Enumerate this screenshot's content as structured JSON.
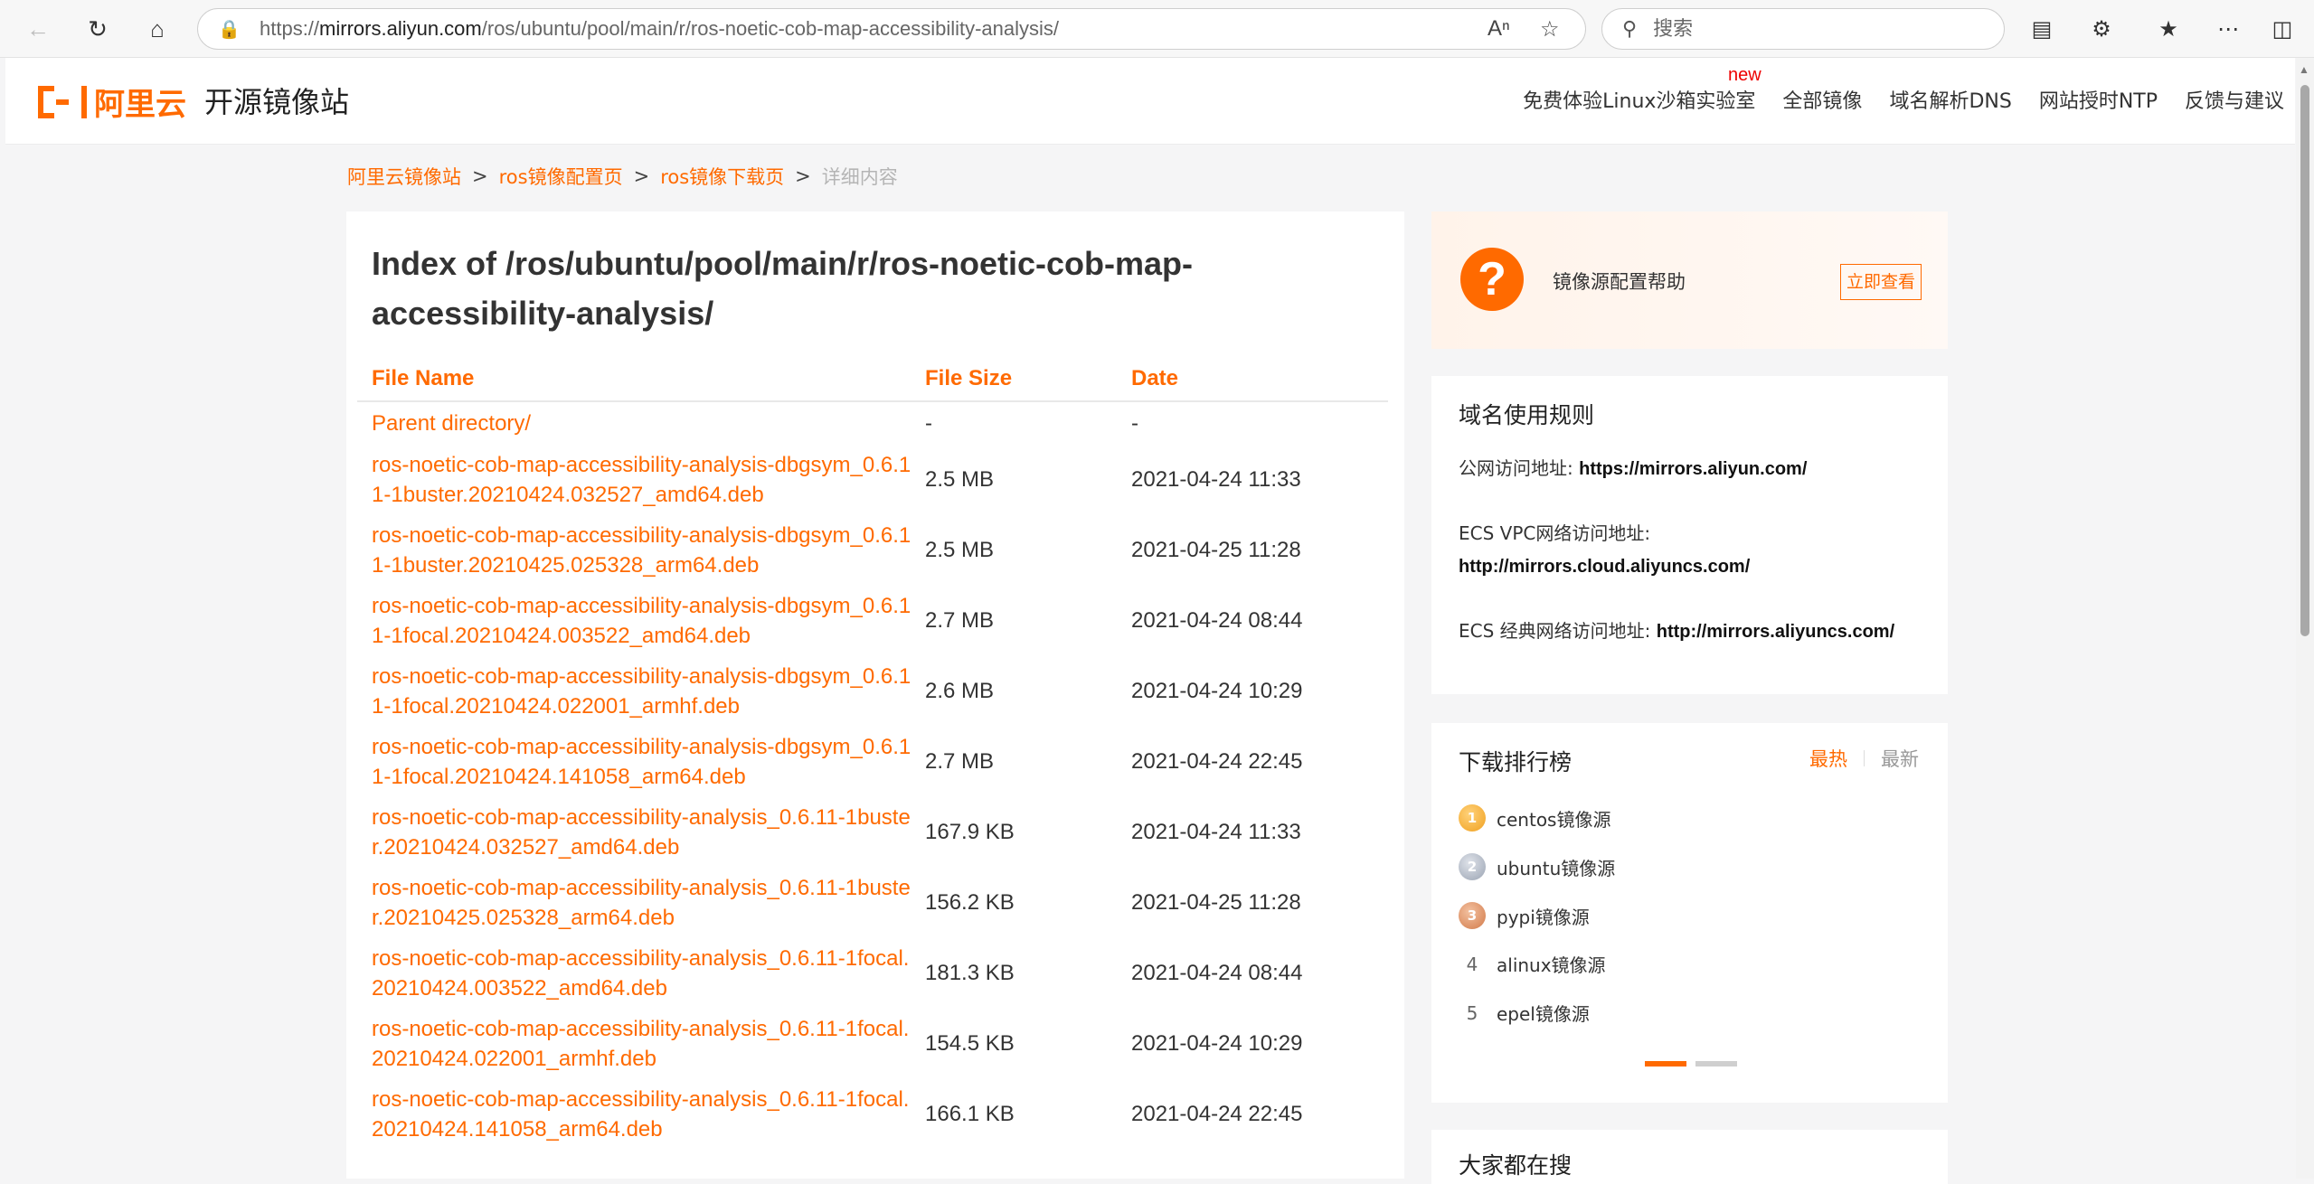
{
  "browser": {
    "url_prefix": "https://",
    "url_domain": "mirrors.aliyun.com",
    "url_path": "/ros/ubuntu/pool/main/r/ros-noetic-cob-map-accessibility-analysis/",
    "search_placeholder": "搜索",
    "icons": [
      "back-arrow-icon",
      "refresh-icon",
      "home-icon",
      "lock-icon",
      "read-aloud-icon",
      "favorite-star-icon",
      "search-icon",
      "reading-mode-icon",
      "extensions-icon",
      "favorites-icon",
      "more-icon",
      "sidebar-icon"
    ]
  },
  "site": {
    "logo_text": "阿里云",
    "title": "开源镜像站",
    "nav": [
      "免费体验Linux沙箱实验室",
      "全部镜像",
      "域名解析DNS",
      "网站授时NTP",
      "反馈与建议"
    ],
    "new_badge": "new"
  },
  "breadcrumb": {
    "items": [
      "阿里云镜像站",
      "ros镜像配置页",
      "ros镜像下载页"
    ],
    "separator": ">",
    "current": "详细内容"
  },
  "index": {
    "title": "Index of /ros/ubuntu/pool/main/r/ros-noetic-cob-map-accessibility-analysis/",
    "headers": {
      "name": "File Name",
      "size": "File Size",
      "date": "Date"
    },
    "parent": {
      "name": "Parent directory/",
      "size": "-",
      "date": "-"
    },
    "files": [
      {
        "name": "ros-noetic-cob-map-accessibility-analysis-dbgsym_0.6.11-1buster.20210424.032527_amd64.deb",
        "size": "2.5 MB",
        "date": "2021-04-24 11:33"
      },
      {
        "name": "ros-noetic-cob-map-accessibility-analysis-dbgsym_0.6.11-1buster.20210425.025328_arm64.deb",
        "size": "2.5 MB",
        "date": "2021-04-25 11:28"
      },
      {
        "name": "ros-noetic-cob-map-accessibility-analysis-dbgsym_0.6.11-1focal.20210424.003522_amd64.deb",
        "size": "2.7 MB",
        "date": "2021-04-24 08:44"
      },
      {
        "name": "ros-noetic-cob-map-accessibility-analysis-dbgsym_0.6.11-1focal.20210424.022001_armhf.deb",
        "size": "2.6 MB",
        "date": "2021-04-24 10:29"
      },
      {
        "name": "ros-noetic-cob-map-accessibility-analysis-dbgsym_0.6.11-1focal.20210424.141058_arm64.deb",
        "size": "2.7 MB",
        "date": "2021-04-24 22:45"
      },
      {
        "name": "ros-noetic-cob-map-accessibility-analysis_0.6.11-1buster.20210424.032527_amd64.deb",
        "size": "167.9 KB",
        "date": "2021-04-24 11:33"
      },
      {
        "name": "ros-noetic-cob-map-accessibility-analysis_0.6.11-1buster.20210425.025328_arm64.deb",
        "size": "156.2 KB",
        "date": "2021-04-25 11:28"
      },
      {
        "name": "ros-noetic-cob-map-accessibility-analysis_0.6.11-1focal.20210424.003522_amd64.deb",
        "size": "181.3 KB",
        "date": "2021-04-24 08:44"
      },
      {
        "name": "ros-noetic-cob-map-accessibility-analysis_0.6.11-1focal.20210424.022001_armhf.deb",
        "size": "154.5 KB",
        "date": "2021-04-24 10:29"
      },
      {
        "name": "ros-noetic-cob-map-accessibility-analysis_0.6.11-1focal.20210424.141058_arm64.deb",
        "size": "166.1 KB",
        "date": "2021-04-24 22:45"
      }
    ]
  },
  "help": {
    "text": "镜像源配置帮助",
    "button": "立即查看"
  },
  "rules": {
    "title": "域名使用规则",
    "public_label": "公网访问地址: ",
    "public_url": "https://mirrors.aliyun.com/",
    "vpc_label": "ECS VPC网络访问地址:",
    "vpc_url": "http://mirrors.cloud.aliyuncs.com/",
    "classic_label": "ECS 经典网络访问地址: ",
    "classic_url": "http://mirrors.aliyuncs.com/"
  },
  "ranking": {
    "title": "下载排行榜",
    "tab_hot": "最热",
    "tab_new": "最新",
    "items": [
      {
        "rank": "1",
        "name": "centos镜像源"
      },
      {
        "rank": "2",
        "name": "ubuntu镜像源"
      },
      {
        "rank": "3",
        "name": "pypi镜像源"
      },
      {
        "rank": "4",
        "name": "alinux镜像源"
      },
      {
        "rank": "5",
        "name": "epel镜像源"
      }
    ]
  },
  "hot_search": {
    "title": "大家都在搜"
  },
  "colors": {
    "accent": "#ff6a00",
    "badge": "#e00000"
  }
}
